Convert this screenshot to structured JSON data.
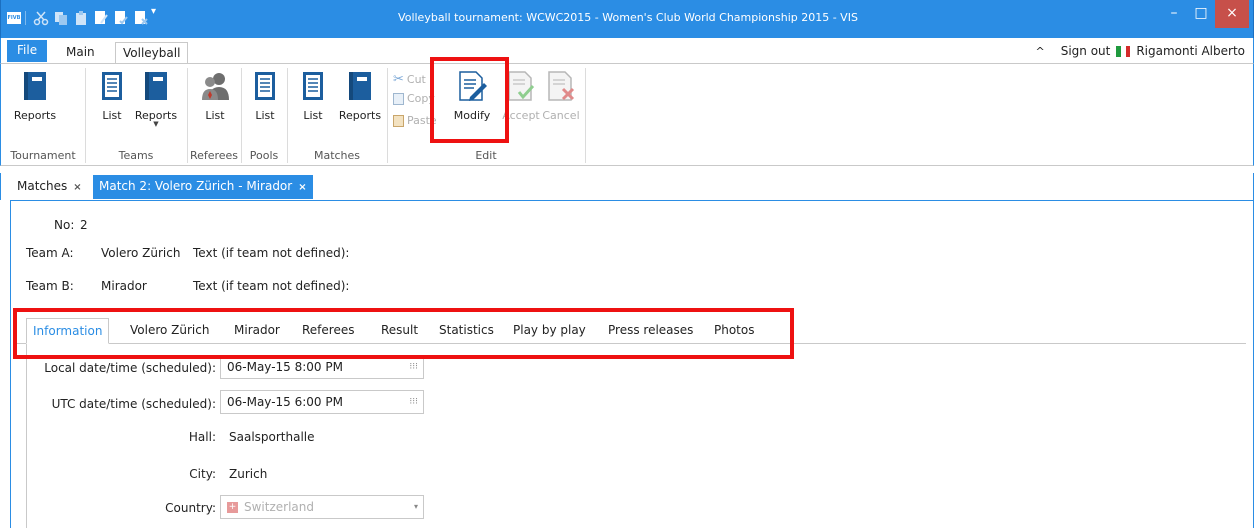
{
  "window": {
    "title": "Volleyball tournament: WCWC2015 - Women's Club World Championship 2015 - VIS",
    "app_icon_text": "FIVB",
    "minimize": "–",
    "maximize": "□",
    "close": "×"
  },
  "ribbon_tabs": [
    "File",
    "Main",
    "Volleyball"
  ],
  "user": {
    "collapse": "^",
    "sign_out": "Sign out",
    "name": "Rigamonti Alberto"
  },
  "ribbon": {
    "tournament_reports": "Reports",
    "teams_list": "List",
    "teams_reports": "Reports",
    "referees_list": "List",
    "pools_list": "List",
    "matches_list": "List",
    "matches_reports": "Reports",
    "cut": "Cut",
    "copy": "Copy",
    "paste": "Paste",
    "modify": "Modify",
    "accept": "Accept",
    "cancel": "Cancel",
    "groups": {
      "tournament": "Tournament",
      "teams": "Teams",
      "referees": "Referees",
      "pools": "Pools",
      "matches": "Matches",
      "edit": "Edit"
    }
  },
  "doc_tabs": {
    "matches": "Matches",
    "match": "Match 2: Volero Zürich - Mirador",
    "close": "×"
  },
  "match": {
    "no_label": "No:",
    "no_value": "2",
    "team_a_label": "Team A:",
    "team_a": "Volero Zürich",
    "team_a_text_label": "Text (if team not defined):",
    "team_b_label": "Team B:",
    "team_b": "Mirador",
    "team_b_text_label": "Text (if team not defined):"
  },
  "sub_tabs": [
    "Information",
    "Volero Zürich",
    "Mirador",
    "Referees",
    "Result",
    "Statistics",
    "Play by play",
    "Press releases",
    "Photos"
  ],
  "information": {
    "local_label": "Local date/time (scheduled):",
    "local_value": "06-May-15 8:00 PM",
    "utc_label": "UTC date/time (scheduled):",
    "utc_value": "06-May-15 6:00 PM",
    "hall_label": "Hall:",
    "hall_value": "Saalsporthalle",
    "city_label": "City:",
    "city_value": "Zurich",
    "country_label": "Country:",
    "country_value": "Switzerland"
  },
  "colors": {
    "accent": "#2b8de4",
    "highlight": "#ee1111"
  }
}
